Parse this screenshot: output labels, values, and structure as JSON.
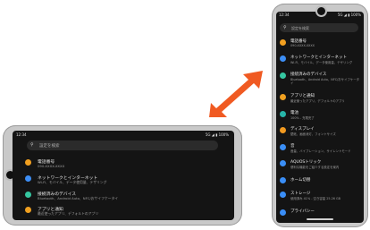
{
  "landscape": {
    "status_time": "12:34",
    "status_right": "5G ◢ ▮ 100%",
    "search_placeholder": "設定を検索",
    "items": [
      {
        "icon": "phone-number-icon",
        "color": "#f2a020",
        "title": "電話番号",
        "subtitle": "090-XXXX-XXXX"
      },
      {
        "icon": "network-icon",
        "color": "#3d8ef5",
        "title": "ネットワークとインターネット",
        "subtitle": "Wi-Fi、モバイル、データ使用量、テザリング"
      },
      {
        "icon": "connected-devices-icon",
        "color": "#35c6a0",
        "title": "接続済みのデバイス",
        "subtitle": "Bluetooth、Android Auto、NFC/おサイフケータイ"
      },
      {
        "icon": "apps-icon",
        "color": "#f0a020",
        "title": "アプリと通知",
        "subtitle": "最近使ったアプリ、デフォルトのアプリ"
      }
    ]
  },
  "portrait": {
    "status_time": "12:34",
    "status_right": "5G ◢ ▮ 100%",
    "search_placeholder": "設定を検索",
    "items": [
      {
        "icon": "phone-number-icon",
        "color": "#f2a020",
        "title": "電話番号",
        "subtitle": "090-XXXX-XXXX",
        "subtitle2": ""
      },
      {
        "icon": "network-icon",
        "color": "#3d8ef5",
        "title": "ネットワークとインターネット",
        "subtitle": "Wi-Fi、モバイル、データ使用量、テザリング",
        "subtitle2": ""
      },
      {
        "icon": "connected-devices-icon",
        "color": "#35c6a0",
        "title": "接続済みのデバイス",
        "subtitle": "Bluetooth、Android Auto、NFC/おサイフケータ",
        "subtitle2": "イ"
      },
      {
        "icon": "apps-icon",
        "color": "#f0a020",
        "title": "アプリと通知",
        "subtitle": "最近使ったアプリ、デフォルトのアプリ",
        "subtitle2": ""
      },
      {
        "icon": "battery-icon",
        "color": "#27b5a8",
        "title": "電池",
        "subtitle": "100% - 充電完了",
        "subtitle2": ""
      },
      {
        "icon": "display-icon",
        "color": "#f29a20",
        "title": "ディスプレイ",
        "subtitle": "壁紙、画面消灯、フォントサイズ",
        "subtitle2": ""
      },
      {
        "icon": "sound-icon",
        "color": "#3a8ef6",
        "title": "音",
        "subtitle": "音量、バイブレーション、サイレントモード",
        "subtitle2": ""
      },
      {
        "icon": "aquos-trick-icon",
        "color": "#3a8ef6",
        "title": "AQUOSトリック",
        "subtitle": "便利な機能をご紹介する設定を案内",
        "subtitle2": ""
      },
      {
        "icon": "home-switch-icon",
        "color": "#3a8ef6",
        "title": "ホーム切替",
        "subtitle": "",
        "subtitle2": ""
      },
      {
        "icon": "storage-icon",
        "color": "#3a8ef6",
        "title": "ストレージ",
        "subtitle": "使用済み 41% - 空き容量 25.26 GB",
        "subtitle2": ""
      },
      {
        "icon": "privacy-icon",
        "color": "#3a8ef6",
        "title": "プライバシー",
        "subtitle": "",
        "subtitle2": ""
      }
    ]
  },
  "arrow": {
    "color": "#f05a22"
  }
}
